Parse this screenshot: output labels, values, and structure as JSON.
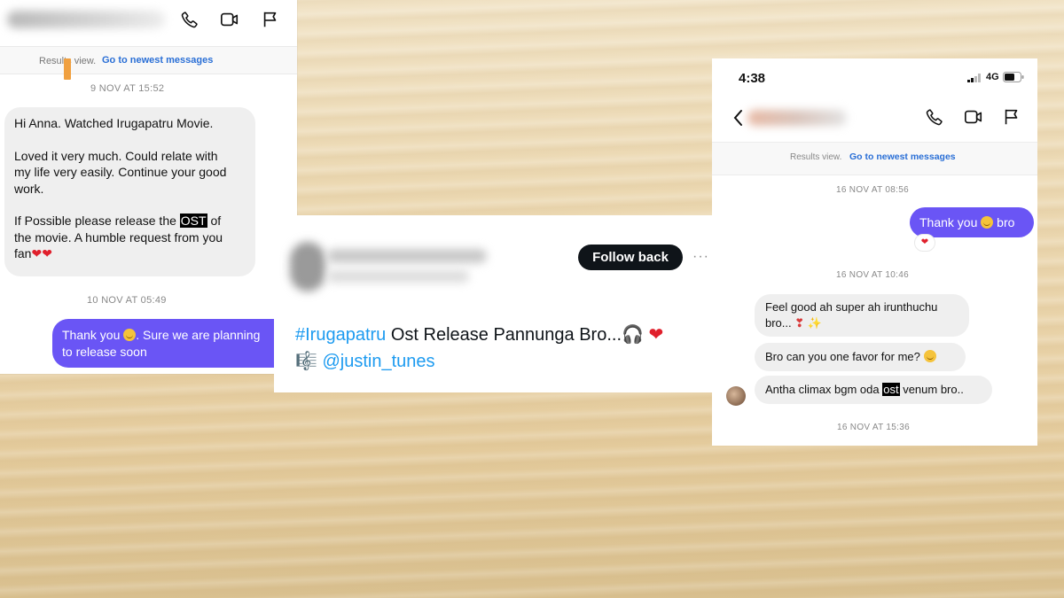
{
  "panel_left": {
    "results_text": "Results view.",
    "results_link": "Go to newest messages",
    "date_1": "9 NOV AT 15:52",
    "incoming_lines": {
      "l1": "Hi Anna. Watched Irugapatru Movie.",
      "l2": "Loved it very much. Could relate with",
      "l3": "my life very easily. Continue your good",
      "l4": "work.",
      "l5a": "If Possible please release the ",
      "l5b": "OST",
      "l5c": " of",
      "l6": "the movie. A humble request from you",
      "l7": "fan",
      "hearts": "❤❤"
    },
    "date_2": "10 NOV AT 05:49",
    "outgoing_a": "Thank you",
    "outgoing_b": ". Sure we are planning",
    "outgoing_c": "to release soon"
  },
  "panel_tweet": {
    "follow_button": "Follow back",
    "more": "···",
    "hashtag": "#Irugapatru",
    "text": " Ost Release Pannunga Bro...",
    "headphones": "🎧",
    "heart": " ❤",
    "music_note": "🎼",
    "mention": "@justin_tunes"
  },
  "panel_right": {
    "time": "4:38",
    "network": "4G",
    "results_text": "Results view.",
    "results_link": "Go to newest messages",
    "date_1": "16 NOV AT 08:56",
    "outgoing_a": "Thank you",
    "outgoing_b": "bro",
    "reaction": "❤",
    "date_2": "16 NOV AT 10:46",
    "msg1_line1": "Feel good ah super ah irunthuchu",
    "msg1_line2": "bro...",
    "msg1_emoji": "❣ ✨",
    "msg2": "Bro can you one favor for me?",
    "msg3a": "Antha climax bgm oda ",
    "msg3b": "ost",
    "msg3c": " venum bro..",
    "date_3": "16 NOV AT 15:36"
  },
  "colors": {
    "outgoing_bubble": "#6a55f5",
    "incoming_bubble": "#efefef",
    "link": "#1d9bf0",
    "ig_link": "#2a6fd6"
  },
  "icons": [
    "phone-icon",
    "video-icon",
    "flag-icon",
    "back-chevron-icon",
    "signal-icon",
    "battery-icon"
  ]
}
